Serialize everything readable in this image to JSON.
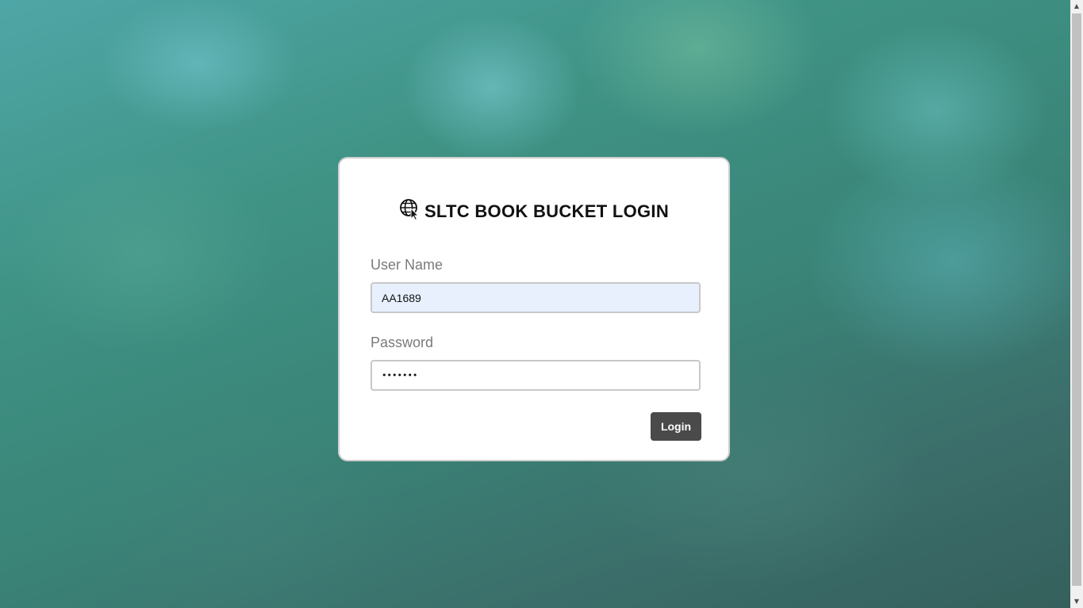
{
  "login": {
    "title": "SLTC BOOK BUCKET LOGIN",
    "title_icon": "globe-cursor-icon",
    "username_label": "User Name",
    "username_value": "AA1689",
    "password_label": "Password",
    "password_value": "•••••••",
    "login_button": "Login"
  },
  "colors": {
    "button_bg": "#4a4a4a",
    "autofill_bg": "#e8f0fe",
    "card_bg": "#ffffff"
  },
  "scrollbar": {
    "up_arrow": "▲",
    "down_arrow": "▼"
  }
}
